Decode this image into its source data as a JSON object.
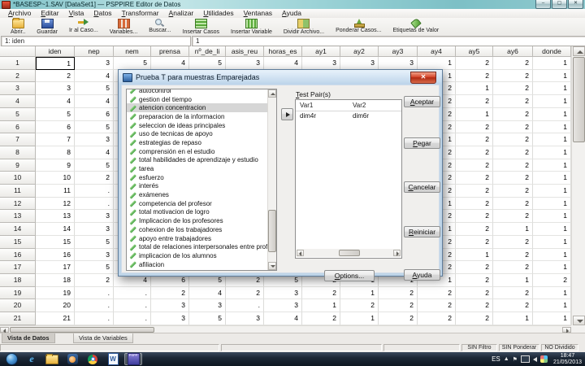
{
  "window": {
    "title": "*BASESP~1.SAV [DataSet1] — PSPPIRE Editor de Datos",
    "controls": {
      "minimize": "–",
      "maximize": "▢",
      "close": "✕"
    }
  },
  "menu": {
    "items": [
      {
        "label": "Archivo",
        "name": "menu-archivo"
      },
      {
        "label": "Editar",
        "name": "menu-editar"
      },
      {
        "label": "Vista",
        "name": "menu-vista"
      },
      {
        "label": "Datos",
        "name": "menu-datos"
      },
      {
        "label": "Transformar",
        "name": "menu-transformar"
      },
      {
        "label": "Analizar",
        "name": "menu-analizar"
      },
      {
        "label": "Utilidades",
        "name": "menu-utilidades"
      },
      {
        "label": "Ventanas",
        "name": "menu-ventanas"
      },
      {
        "label": "Ayuda",
        "name": "menu-ayuda"
      }
    ]
  },
  "toolbar": {
    "items": [
      {
        "label": "Abrir..",
        "icon": "icon-open",
        "name": "toolbar-open-button",
        "cls": ""
      },
      {
        "label": "Guardar",
        "icon": "icon-save",
        "name": "toolbar-save-button",
        "cls": ""
      },
      {
        "label": "Ir al Caso...",
        "icon": "icon-goto",
        "name": "toolbar-goto-case-button",
        "cls": "sep-before"
      },
      {
        "label": "Variables...",
        "icon": "icon-variables",
        "name": "toolbar-variables-button",
        "cls": ""
      },
      {
        "label": "Buscar...",
        "icon": "icon-search",
        "name": "toolbar-find-button",
        "cls": "sep-before"
      },
      {
        "label": "Insertar Casos",
        "icon": "icon-insert-cases",
        "name": "toolbar-insert-cases-button",
        "cls": "sep-before"
      },
      {
        "label": "Insertar Variable",
        "icon": "icon-insert-variable",
        "name": "toolbar-insert-variable-button",
        "cls": ""
      },
      {
        "label": "Dividir Archivo...",
        "icon": "icon-split",
        "name": "toolbar-split-file-button",
        "cls": "sep-before"
      },
      {
        "label": "Ponderar Casos...",
        "icon": "icon-weight",
        "name": "toolbar-weight-cases-button",
        "cls": ""
      },
      {
        "label": "Etiquetas de Valor",
        "icon": "icon-labels",
        "name": "toolbar-value-labels-button",
        "cls": ""
      }
    ]
  },
  "cell_reference": {
    "reference": "1: iden",
    "value": "1"
  },
  "grid": {
    "columns": [
      "iden",
      "nep",
      "nem",
      "prensa",
      "nº_de_li",
      "asis_reu",
      "horas_es",
      "ay1",
      "ay2",
      "ay3",
      "ay4",
      "ay5",
      "ay6",
      "donde"
    ],
    "selected_cell": {
      "row_index": 0,
      "col_index": 0
    },
    "rows": [
      {
        "num": "1",
        "values": [
          "1",
          "3",
          "5",
          "4",
          "5",
          "3",
          "4",
          "3",
          "3",
          "3",
          "1",
          "2",
          "2",
          "1"
        ]
      },
      {
        "num": "2",
        "values": [
          "2",
          "4",
          "",
          "",
          "",
          "",
          "",
          "",
          "",
          "",
          "1",
          "2",
          "2",
          "1"
        ]
      },
      {
        "num": "3",
        "values": [
          "3",
          "5",
          "",
          "",
          "",
          "",
          "",
          "",
          "",
          "",
          "2",
          "1",
          "2",
          "1"
        ]
      },
      {
        "num": "4",
        "values": [
          "4",
          "4",
          "",
          "",
          "",
          "",
          "",
          "",
          "",
          "",
          "2",
          "2",
          "2",
          "1"
        ]
      },
      {
        "num": "5",
        "values": [
          "5",
          "6",
          "",
          "",
          "",
          "",
          "",
          "",
          "",
          "",
          "2",
          "1",
          "2",
          "1"
        ]
      },
      {
        "num": "6",
        "values": [
          "6",
          "5",
          "",
          "",
          "",
          "",
          "",
          "",
          "",
          "",
          "2",
          "2",
          "2",
          "1"
        ]
      },
      {
        "num": "7",
        "values": [
          "7",
          "3",
          "",
          "",
          "",
          "",
          "",
          "",
          "",
          "",
          "1",
          "2",
          "2",
          "1"
        ]
      },
      {
        "num": "8",
        "values": [
          "8",
          "4",
          "",
          "",
          "",
          "",
          "",
          "",
          "",
          "",
          "2",
          "2",
          "2",
          "1"
        ]
      },
      {
        "num": "9",
        "values": [
          "9",
          "5",
          "",
          "",
          "",
          "",
          "",
          "",
          "",
          "",
          "2",
          "2",
          "2",
          "1"
        ]
      },
      {
        "num": "10",
        "values": [
          "10",
          "2",
          "",
          "",
          "",
          "",
          "",
          "",
          "",
          "",
          "2",
          "2",
          "2",
          "1"
        ]
      },
      {
        "num": "11",
        "values": [
          "11",
          ".",
          "",
          "",
          "",
          "",
          "",
          "",
          "",
          "",
          "2",
          "2",
          "2",
          "1"
        ]
      },
      {
        "num": "12",
        "values": [
          "12",
          ".",
          "",
          "",
          "",
          "",
          "",
          "",
          "",
          "",
          "1",
          "2",
          "2",
          "1"
        ]
      },
      {
        "num": "13",
        "values": [
          "13",
          "3",
          "",
          "",
          "",
          "",
          "",
          "",
          "",
          "",
          "2",
          "2",
          "2",
          "1"
        ]
      },
      {
        "num": "14",
        "values": [
          "14",
          "3",
          "",
          "",
          "",
          "",
          "",
          "",
          "",
          "",
          "1",
          "2",
          "1",
          "1"
        ]
      },
      {
        "num": "15",
        "values": [
          "15",
          "5",
          "",
          "",
          "",
          "",
          "",
          "",
          "",
          "",
          "2",
          "2",
          "2",
          "1"
        ]
      },
      {
        "num": "16",
        "values": [
          "16",
          "3",
          "",
          "",
          "",
          "",
          "",
          "",
          "",
          "",
          "2",
          "1",
          "2",
          "1"
        ]
      },
      {
        "num": "17",
        "values": [
          "17",
          "5",
          "",
          "",
          "",
          "",
          "",
          "",
          "",
          "",
          "2",
          "2",
          "2",
          "1"
        ]
      },
      {
        "num": "18",
        "values": [
          "18",
          "2",
          "4",
          "6",
          "5",
          "2",
          "5",
          "2",
          "1",
          "1",
          "1",
          "2",
          "1",
          "2"
        ]
      },
      {
        "num": "19",
        "values": [
          "19",
          ".",
          ".",
          "2",
          "4",
          "2",
          "3",
          "2",
          "1",
          "2",
          "2",
          "2",
          "2",
          "1"
        ]
      },
      {
        "num": "20",
        "values": [
          "20",
          ".",
          ".",
          "3",
          "3",
          ".",
          "3",
          "1",
          "2",
          "2",
          "2",
          "2",
          "2",
          "1"
        ]
      },
      {
        "num": "21",
        "values": [
          "21",
          ".",
          ".",
          "3",
          "5",
          "3",
          "4",
          "2",
          "1",
          "2",
          "2",
          "2",
          "1",
          "1"
        ]
      }
    ]
  },
  "dialog": {
    "title": "Prueba T para muestras Emparejadas",
    "close_label": "✕",
    "variables": {
      "selected_index": 2,
      "items": [
        "autocontrol",
        "gestion del tiempo",
        "atencion concentracion",
        "preparacion de la informacion",
        "seleccion de ideas principales",
        "uso de tecnicas de apoyo",
        "estrategias de repaso",
        "comprensión en el estudio",
        "total habilidades de aprendizaje y estudio",
        "tarea",
        "esfuerzo",
        "interés",
        "exámenes",
        "competencia del profesor",
        "total motivacion de logro",
        "Implicacion de los profesores",
        "cohexion de los trabajadores",
        "apoyo entre trabajadores",
        "total de relaciones interpersonales entre profesores",
        "implicacion de los alumnos",
        "afiliacion"
      ]
    },
    "pairs": {
      "label": "Test Pair(s)",
      "columns": [
        "Var1",
        "Var2"
      ],
      "rows": [
        [
          "dim4r",
          "dim6r"
        ]
      ]
    },
    "buttons": {
      "accept": "Aceptar",
      "paste": "Pegar",
      "cancel": "Cancelar",
      "reset": "Reiniciar",
      "help": "Ayuda",
      "options": "Options..."
    }
  },
  "tabs": {
    "data_view": "Vista de Datos",
    "variable_view": "Vista de Variables"
  },
  "statusbar": {
    "filter": "SIN Filtro",
    "weight": "SIN Ponderar",
    "split": "NO Dividido"
  },
  "tray": {
    "language": "ES",
    "time": "18:47",
    "date": "21/05/2013"
  }
}
